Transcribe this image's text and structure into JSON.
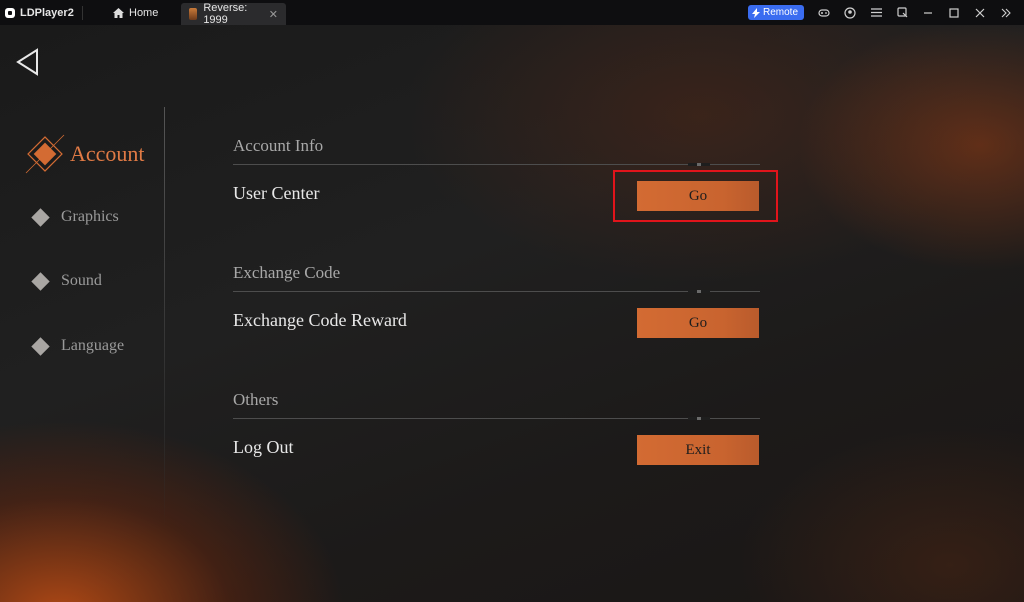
{
  "titlebar": {
    "app_name": "LDPlayer2",
    "home_tab": "Home",
    "game_tab": "Reverse: 1999",
    "remote_label": "Remote"
  },
  "nav": {
    "items": [
      {
        "label": "Account",
        "active": true
      },
      {
        "label": "Graphics",
        "active": false
      },
      {
        "label": "Sound",
        "active": false
      },
      {
        "label": "Language",
        "active": false
      }
    ]
  },
  "sections": [
    {
      "title": "Account Info",
      "row_label": "User Center",
      "button": "Go"
    },
    {
      "title": "Exchange Code",
      "row_label": "Exchange Code Reward",
      "button": "Go"
    },
    {
      "title": "Others",
      "row_label": "Log Out",
      "button": "Exit"
    }
  ],
  "colors": {
    "accent": "#d36b33",
    "highlight_box": "#e1141b",
    "remote_badge": "#3a6cf0"
  }
}
